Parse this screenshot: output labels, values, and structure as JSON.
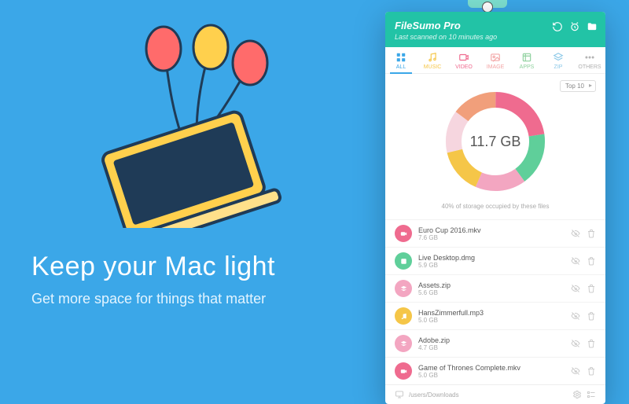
{
  "marketing": {
    "headline": "Keep your Mac light",
    "subhead": "Get more space for things that matter"
  },
  "app": {
    "title": "FileSumo Pro",
    "last_scan": "Last scanned on 10 minutes ago",
    "tabs": [
      {
        "key": "all",
        "label": "ALL"
      },
      {
        "key": "music",
        "label": "MUSIC"
      },
      {
        "key": "video",
        "label": "VIDEO"
      },
      {
        "key": "image",
        "label": "IMAGE"
      },
      {
        "key": "apps",
        "label": "APPS"
      },
      {
        "key": "zip",
        "label": "ZIP"
      },
      {
        "key": "others",
        "label": "OTHERS"
      }
    ],
    "active_tab": "all",
    "top_selector": "Top 10",
    "total_size": "11.7 GB",
    "storage_caption": "40% of storage occupied by these files",
    "files": [
      {
        "name": "Euro Cup 2016.mkv",
        "size": "7.6 GB",
        "kind": "video",
        "color": "#ef6b8f"
      },
      {
        "name": "Live Desktop.dmg",
        "size": "5.9 GB",
        "kind": "apps",
        "color": "#5fcf9a"
      },
      {
        "name": "Assets.zip",
        "size": "5.6 GB",
        "kind": "zip",
        "color": "#f3a6c1"
      },
      {
        "name": "HansZimmerfull.mp3",
        "size": "5.0 GB",
        "kind": "music",
        "color": "#f5c648"
      },
      {
        "name": "Adobe.zip",
        "size": "4.7 GB",
        "kind": "zip",
        "color": "#f3a6c1"
      },
      {
        "name": "Game of Thrones Complete.mkv",
        "size": "5.0 GB",
        "kind": "video",
        "color": "#ef6b8f"
      }
    ],
    "footer_path": "/users/Downloads"
  },
  "chart_data": {
    "type": "pie",
    "title": "Storage by file",
    "total_label": "11.7 GB",
    "series": [
      {
        "name": "Euro Cup 2016.mkv",
        "value": 7.6,
        "color": "#ef6b8f"
      },
      {
        "name": "Live Desktop.dmg",
        "value": 5.9,
        "color": "#5fcf9a"
      },
      {
        "name": "Assets.zip",
        "value": 5.6,
        "color": "#f3a6c1"
      },
      {
        "name": "HansZimmerfull.mp3",
        "value": 5.0,
        "color": "#f5c648"
      },
      {
        "name": "Adobe.zip",
        "value": 4.7,
        "color": "#f6d6df"
      },
      {
        "name": "Game of Thrones Complete.mkv",
        "value": 5.0,
        "color": "#f19f7b"
      }
    ],
    "unit": "GB"
  }
}
